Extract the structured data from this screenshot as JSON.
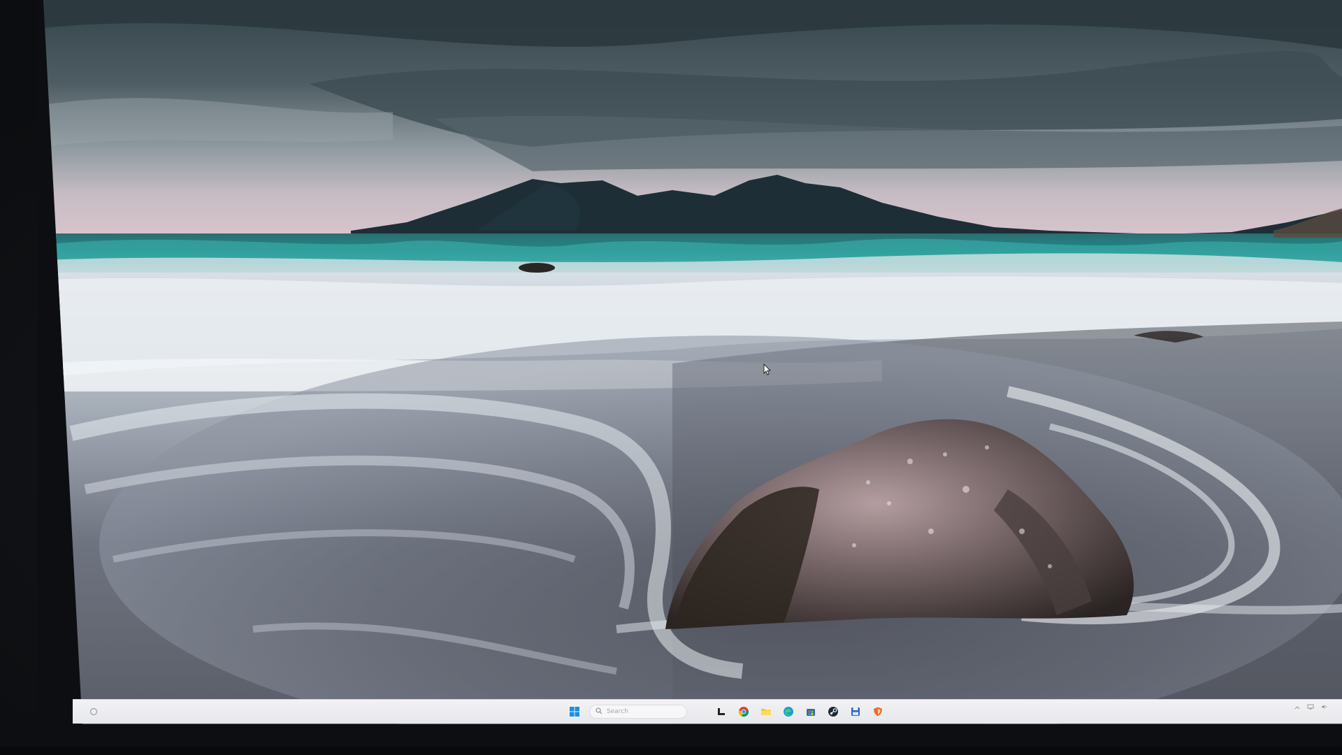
{
  "taskbar": {
    "search_placeholder": "Search",
    "icons": [
      "start-icon",
      "search-icon",
      "task-view-icon",
      "chrome-icon",
      "file-explorer-icon",
      "edge-icon",
      "store-icon",
      "steam-icon",
      "save-icon",
      "shield-icon"
    ]
  },
  "colors": {
    "taskbar_bg": "#eeeff2",
    "sea_teal": "#1f8c8a",
    "sky_grey": "#4d5a60",
    "mountain": "#1d2e36",
    "dusk_pink": "#cbb7bf"
  }
}
